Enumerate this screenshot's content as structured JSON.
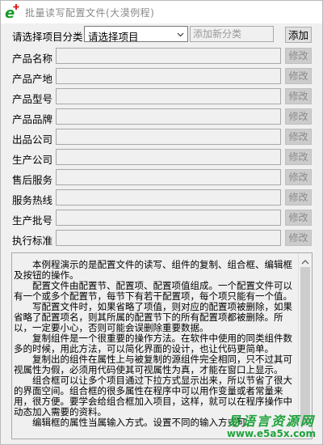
{
  "window": {
    "title": "批量读写配置文件(大漠例程)"
  },
  "category": {
    "label": "请选择项目分类",
    "selected": "请选择项目",
    "new_placeholder": "添加新分类",
    "add_label": "添加"
  },
  "fields": [
    {
      "label": "产品名称",
      "value": "",
      "edit_label": "修改"
    },
    {
      "label": "产品产地",
      "value": "",
      "edit_label": "修改"
    },
    {
      "label": "产品型号",
      "value": "",
      "edit_label": "修改"
    },
    {
      "label": "产品品牌",
      "value": "",
      "edit_label": "修改"
    },
    {
      "label": "出品公司",
      "value": "",
      "edit_label": "修改"
    },
    {
      "label": "生产公司",
      "value": "",
      "edit_label": "修改"
    },
    {
      "label": "售后服务",
      "value": "",
      "edit_label": "修改"
    },
    {
      "label": "服务热线",
      "value": "",
      "edit_label": "修改"
    },
    {
      "label": "生产批号",
      "value": "",
      "edit_label": "修改"
    },
    {
      "label": "执行标准",
      "value": "",
      "edit_label": "修改"
    }
  ],
  "description": "　　本例程演示的是配置文件的读写、组件的复制、组合框、编辑框及按钮的操作。\n　　配置文件由配置节、配置项、配置项值组成。一个配置文件可以有一个或多个配置节，每节下有若干配置项，每个项只能有一个值。\n　　写配置文件时，如果省略了项值，则对应的配置项被删除，如果省略了配置项名，则其所属的配置节下的所有配置项都被删除。所以，一定要小心，否则可能会误删除重要数据。\n　　复制组件是一个很重要的操作方法。在软件中使用的同类组件数多的时候，用此方法，可以简化界面的设计，也让代码更简单。\n　　复制出的组件在属性上与被复制的源组件完全相同，只不过其可视属性为假，必须用代码使其可视属性为真，才能在窗口上显示。\n　　组合框可以让多个项目通过下拉方式显示出来，所以节省了很大的界面空间。组合框的很多属性在程序中可以用作变量或者常量来用，很方便。要学会给组合框加入项目，这样，就可以在程序操作中动态加入需要的资料。\n　　编辑框的属性当属输入方式。设置不同的输入方式可",
  "watermark": {
    "name": "易语言资源网",
    "url": "www.e5a5x.com"
  },
  "colors": {
    "icon_green": "#1a9a2a",
    "icon_red": "#e02020",
    "watermark": "#1fa33c"
  }
}
